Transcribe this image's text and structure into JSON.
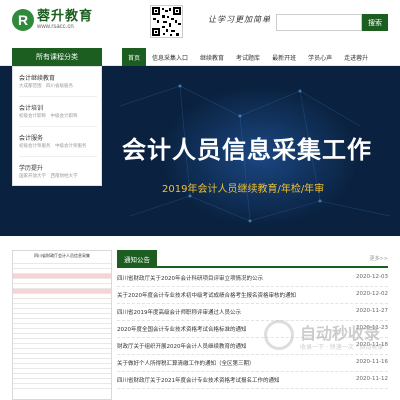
{
  "header": {
    "logo_mark": "R",
    "logo_name": "蓉升教育",
    "logo_url": "www.rsacc.cn",
    "slogan": "让学习更加简单",
    "search_button": "搜索"
  },
  "nav": {
    "category_label": "所有课程分类",
    "items": [
      {
        "label": "首页",
        "active": true
      },
      {
        "label": "信息采集入口",
        "active": false
      },
      {
        "label": "继续教育",
        "active": false
      },
      {
        "label": "考试题库",
        "active": false
      },
      {
        "label": "最新开班",
        "active": false
      },
      {
        "label": "学员心声",
        "active": false
      },
      {
        "label": "走进蓉升",
        "active": false
      }
    ]
  },
  "category_panel": {
    "groups": [
      {
        "title": "会计继续教育",
        "sub": "大成都范围　四川省级服务"
      },
      {
        "title": "会计培训",
        "sub": "初级会计职称　中级会计职称"
      },
      {
        "title": "会计服务",
        "sub": "初级会计师服务　中级会计师服务"
      },
      {
        "title": "学历提升",
        "sub": "国家开放大学　西南财经大学"
      }
    ]
  },
  "banner": {
    "title": "会计人员信息采集工作",
    "subtitle": "2019年会计人员继续教育/年检/年审"
  },
  "notice": {
    "tab_label": "通知公告",
    "more_label": "更多>>",
    "items": [
      {
        "text": "四川省财政厅关于2020年会计科研项目评审立项情况的公示",
        "date": "2020-12-03"
      },
      {
        "text": "关于2020年度会计专业技术初中级考试成绩合格考生报名资格审核的通知",
        "date": "2020-12-02"
      },
      {
        "text": "四川省2019年度高级会计师职称评审通过人员公示",
        "date": "2020-11-27"
      },
      {
        "text": "2020年度全国会计专业技术资格考试合格标准的通知",
        "date": "2020-11-23"
      },
      {
        "text": "财政厅关于组织开展2020年会计人员继续教育的通知",
        "date": "2020-11-18"
      },
      {
        "text": "关于做好个人所得税汇算清缴工作的通知（全区第三期）",
        "date": "2020-11-16"
      },
      {
        "text": "四川省财政厅关于2021年度会计专业技术资格考试报名工作的通知",
        "date": "2020-11-12"
      }
    ]
  },
  "watermark": {
    "text": "自动秒收录",
    "sub": "收录一下 · 快速一次 · 自动收录"
  },
  "doc": {
    "title": "四川省财政厅会计人员信息采集",
    "highlight_rows": [
      3,
      6
    ]
  }
}
